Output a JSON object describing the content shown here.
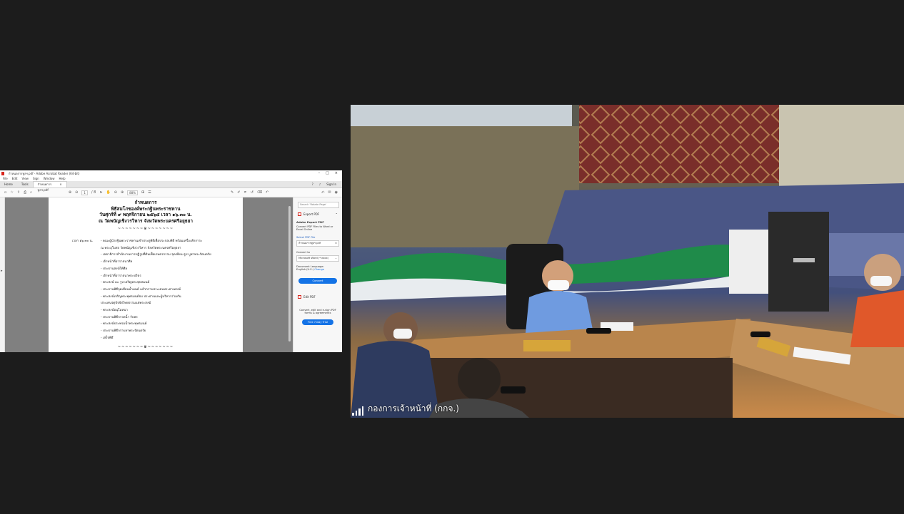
{
  "acrobat": {
    "title": "กำหนดการทูลฯ.pdf - Adobe Acrobat Reader (64-bit)",
    "menu": [
      "File",
      "Edit",
      "View",
      "Sign",
      "Window",
      "Help"
    ],
    "tabs": {
      "home": "Home",
      "tools": "Tools",
      "doc": "กำหนดการทูลฯ.pdf",
      "sign_in": "Sign In"
    },
    "toolbar": {
      "page_current": "1",
      "page_total": "/ 8",
      "zoom": "88%"
    },
    "page": {
      "heading": [
        "กำหนดการ",
        "พิธีสมโภชองค์พระกฐินพระราชทาน",
        "วันศุกร์ที่ ๙ พฤศจิกายน ๒๕๖๕ เวลา ๑๖.๓๐ น.",
        "ณ วัดพนัญเชิงวรวิหาร จังหวัดพระนครศรีอยุธยา"
      ],
      "ornament": "~~~~~~~♛~~~~~~~",
      "time_label": "เวลา ๑๖.๓๐ น.",
      "items": [
        "- คณะผู้นำกฐินพระราชทานเข้าประตูพิธีเพื่อประกอบพิธี พร้อมเครื่องสักการะ",
        "  ณ พระอุโบสถ วัดพนัญเชิงวรวิหาร จังหวัดพระนครศรีอยุธยา",
        "- เลขาธิการสำนักงานการปฏิรูปที่ดินเพื่อเกษตรกรรม จุดเทียน ธูป บูชาพระรัตนตรัย",
        "- เจ้าหน้าที่อาราธนาศีล",
        "- ประธานสงฆ์ให้ศีล",
        "- เจ้าหน้าที่อาราธนาพระปริตร",
        "- พระสงฆ์ ๑๐ รูป เจริญพระพุทธมนต์",
        "- ประธานพิธีจุดเทียนน้ำมนต์ แล้วกราบประเคนประธานสงฆ์",
        "- พระสงฆ์เจริญพระพุทธมนต์จบ ประธานและผู้บริหารร่วมกัน",
        "  ประเคนจตุปัจจัยไทยธรรมแด่พระสงฆ์",
        "- พระสงฆ์อนุโมทนา",
        "- ประธานพิธีกรวดน้ำ รับพร",
        "- พระสงฆ์ประพรมน้ำพระพุทธมนต์",
        "- ประธานพิธีกราบลาพระรัตนตรัย",
        "- เสร็จพิธี"
      ]
    },
    "right_panel": {
      "search_placeholder": "Search 'Rotate Page'",
      "export_header": "Export PDF",
      "card_title": "Adobe Export PDF",
      "card_desc": "Convert PDF Files to Word or Excel Online",
      "select_label": "Select PDF File",
      "selected_file": "กำหนดการทูลฯ.pdf",
      "convert_to_label": "Convert to",
      "convert_to_value": "Microsoft Word (*.docx)",
      "doc_lang_label": "Document Language:",
      "doc_lang_value": "English (U.S.)",
      "change": "Change",
      "convert_button": "Convert",
      "edit_pdf": "Edit PDF",
      "promo": "Convert, edit and e-sign PDF forms & agreements",
      "trial_button": "Free 7-Day Trial"
    }
  },
  "participant": {
    "name": "กองการเจ้าหน้าที่ (กกจ.)",
    "signal_bars": 4
  }
}
